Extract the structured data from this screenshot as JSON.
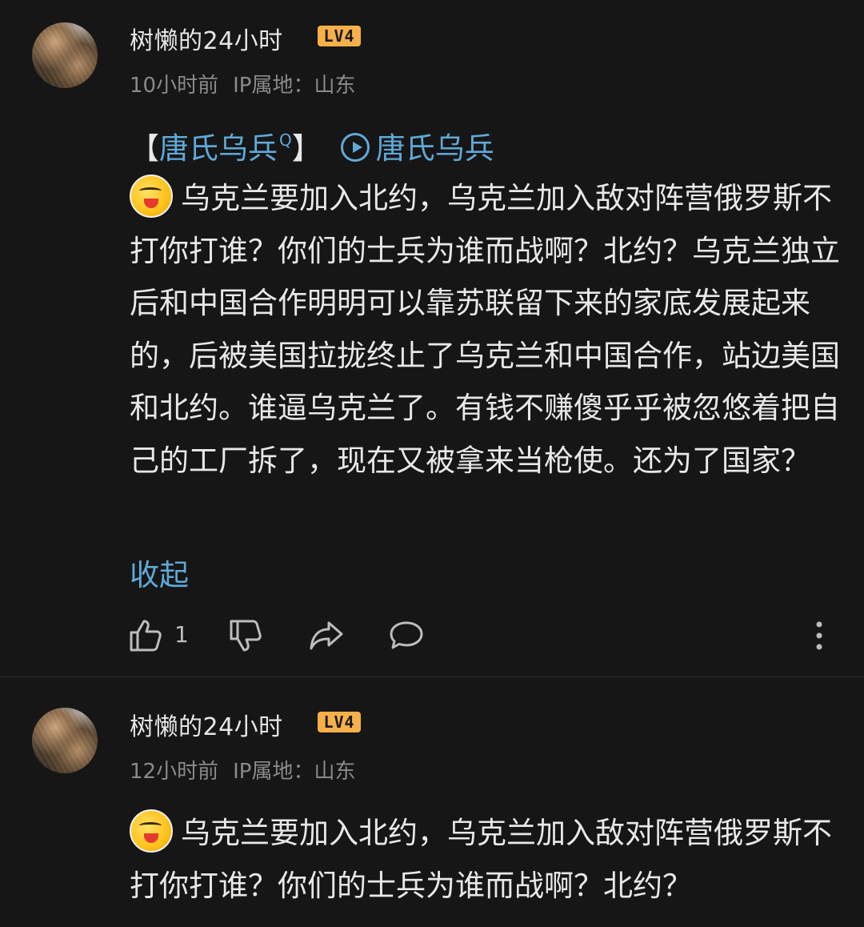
{
  "comments": [
    {
      "username": "树懒的24小时",
      "level": "LV4",
      "time": "10小时前",
      "ip": "IP属地：山东",
      "topic": {
        "bracket_open": "【",
        "name": "唐氏乌兵",
        "search_mark": "Q",
        "bracket_close": "】",
        "video_label": "唐氏乌兵"
      },
      "text": "乌克兰要加入北约，乌克兰加入敌对阵营俄罗斯不打你打谁？你们的士兵为谁而战啊？北约？乌克兰独立后和中国合作明明可以靠苏联留下来的家底发展起来的，后被美国拉拢终止了乌克兰和中国合作，站边美国和北约。谁逼乌克兰了。有钱不赚傻乎乎被忽悠着把自己的工厂拆了，现在又被拿来当枪使。还为了国家？",
      "collapse_label": "收起",
      "like_count": "1"
    },
    {
      "username": "树懒的24小时",
      "level": "LV4",
      "time": "12小时前",
      "ip": "IP属地：山东",
      "text": "乌克兰要加入北约，乌克兰加入敌对阵营俄罗斯不打你打谁？你们的士兵为谁而战啊？北约？"
    }
  ],
  "colors": {
    "background": "#161616",
    "text": "#e8e8e8",
    "meta": "#8a8a8a",
    "link": "#5fa9d8",
    "level_badge": "#f6b04a"
  },
  "icons": [
    "thumbs-up-icon",
    "thumbs-down-icon",
    "share-icon",
    "comment-icon",
    "more-vertical-icon",
    "play-circle-icon",
    "emoji-sticker"
  ]
}
